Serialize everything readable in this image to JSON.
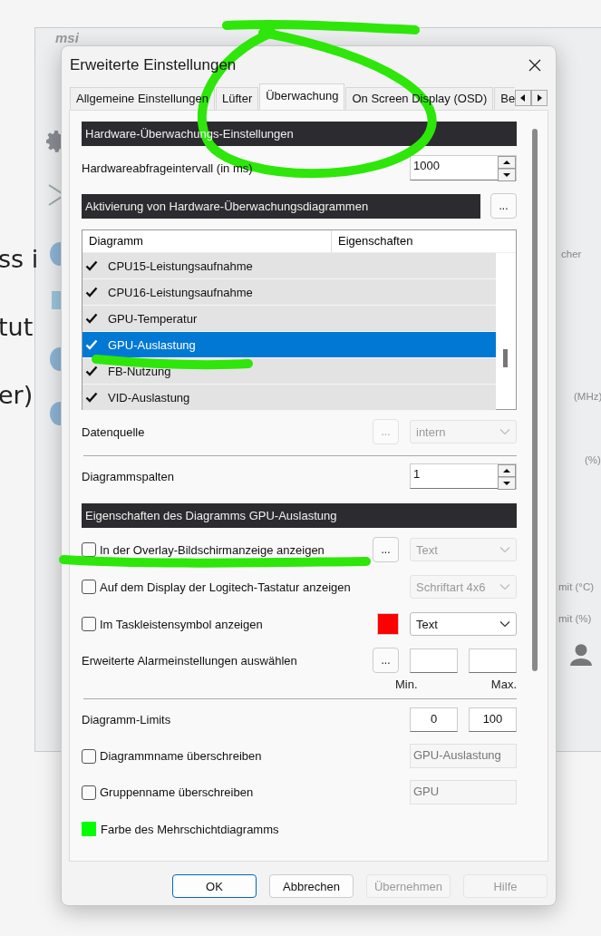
{
  "background_text": [
    "ss i",
    "tut",
    "er)"
  ],
  "app_window": {
    "logo": "msi",
    "side_labels": [
      "cher",
      "(MHz)",
      "(%)",
      "mit (°C)",
      "mit (%)"
    ]
  },
  "dialog": {
    "title": "Erweiterte Einstellungen",
    "tabs": [
      {
        "label": "Allgemeine Einstellungen",
        "selected": false
      },
      {
        "label": "Lüfter",
        "selected": false
      },
      {
        "label": "Überwachung",
        "selected": true
      },
      {
        "label": "On Screen Display (OSD)",
        "selected": false
      },
      {
        "label": "Be",
        "selected": false
      }
    ],
    "controls": [
      {
        "kind": "header",
        "text": "Hardware-Überwachungs-Einstellungen"
      },
      {
        "kind": "spin",
        "label": "Hardwareabfrageintervall (in ms)",
        "value": "1000"
      },
      {
        "kind": "header",
        "text": "Aktivierung von Hardware-Überwachungsdiagrammen",
        "button": "..."
      },
      {
        "kind": "list",
        "columns": [
          "Diagramm",
          "Eigenschaften"
        ],
        "rows": [
          {
            "name": "CPU15-Leistungsaufnahme",
            "checked": true,
            "selected": false
          },
          {
            "name": "CPU16-Leistungsaufnahme",
            "checked": true,
            "selected": false
          },
          {
            "name": "GPU-Temperatur",
            "checked": true,
            "selected": false
          },
          {
            "name": "GPU-Auslastung",
            "checked": true,
            "selected": true
          },
          {
            "name": "FB-Nutzung",
            "checked": true,
            "selected": false
          },
          {
            "name": "VID-Auslastung",
            "checked": true,
            "selected": false
          }
        ]
      },
      {
        "kind": "combo",
        "label": "Datenquelle",
        "button": "...",
        "value": "intern",
        "disabled": true
      },
      {
        "kind": "divider"
      },
      {
        "kind": "spin",
        "label": "Diagrammspalten",
        "value": "1"
      },
      {
        "kind": "header",
        "text": "Eigenschaften des Diagramms GPU-Auslastung"
      },
      {
        "kind": "check_combo",
        "label": "In der Overlay-Bildschirmanzeige anzeigen",
        "checked": false,
        "button": "...",
        "value": "Text",
        "disabled": true
      },
      {
        "kind": "check_combo",
        "label": "Auf dem Display der Logitech-Tastatur anzeigen",
        "checked": false,
        "value": "Schriftart 4x6",
        "disabled": true
      },
      {
        "kind": "check_combo",
        "label": "Im Taskleistensymbol anzeigen",
        "checked": false,
        "color": "#ff0000",
        "value": "Text",
        "disabled": false
      },
      {
        "kind": "alarm",
        "label": "Erweiterte Alarmeinstellungen auswählen",
        "button": "...",
        "min_label": "Min.",
        "max_label": "Max."
      },
      {
        "kind": "divider"
      },
      {
        "kind": "limits",
        "label": "Diagramm-Limits",
        "min": "0",
        "max": "100"
      },
      {
        "kind": "check_field",
        "label": "Diagrammname überschreiben",
        "checked": false,
        "value": "GPU-Auslastung"
      },
      {
        "kind": "check_field",
        "label": "Gruppenname überschreiben",
        "checked": false,
        "value": "GPU"
      },
      {
        "kind": "color",
        "label": "Farbe des Mehrschichtdiagramms",
        "color": "#00ff00"
      }
    ],
    "buttons": [
      {
        "label": "OK",
        "default": true,
        "disabled": false
      },
      {
        "label": "Abbrechen",
        "default": false,
        "disabled": false
      },
      {
        "label": "Übernehmen",
        "default": false,
        "disabled": true
      },
      {
        "label": "Hilfe",
        "default": false,
        "disabled": true
      }
    ]
  }
}
